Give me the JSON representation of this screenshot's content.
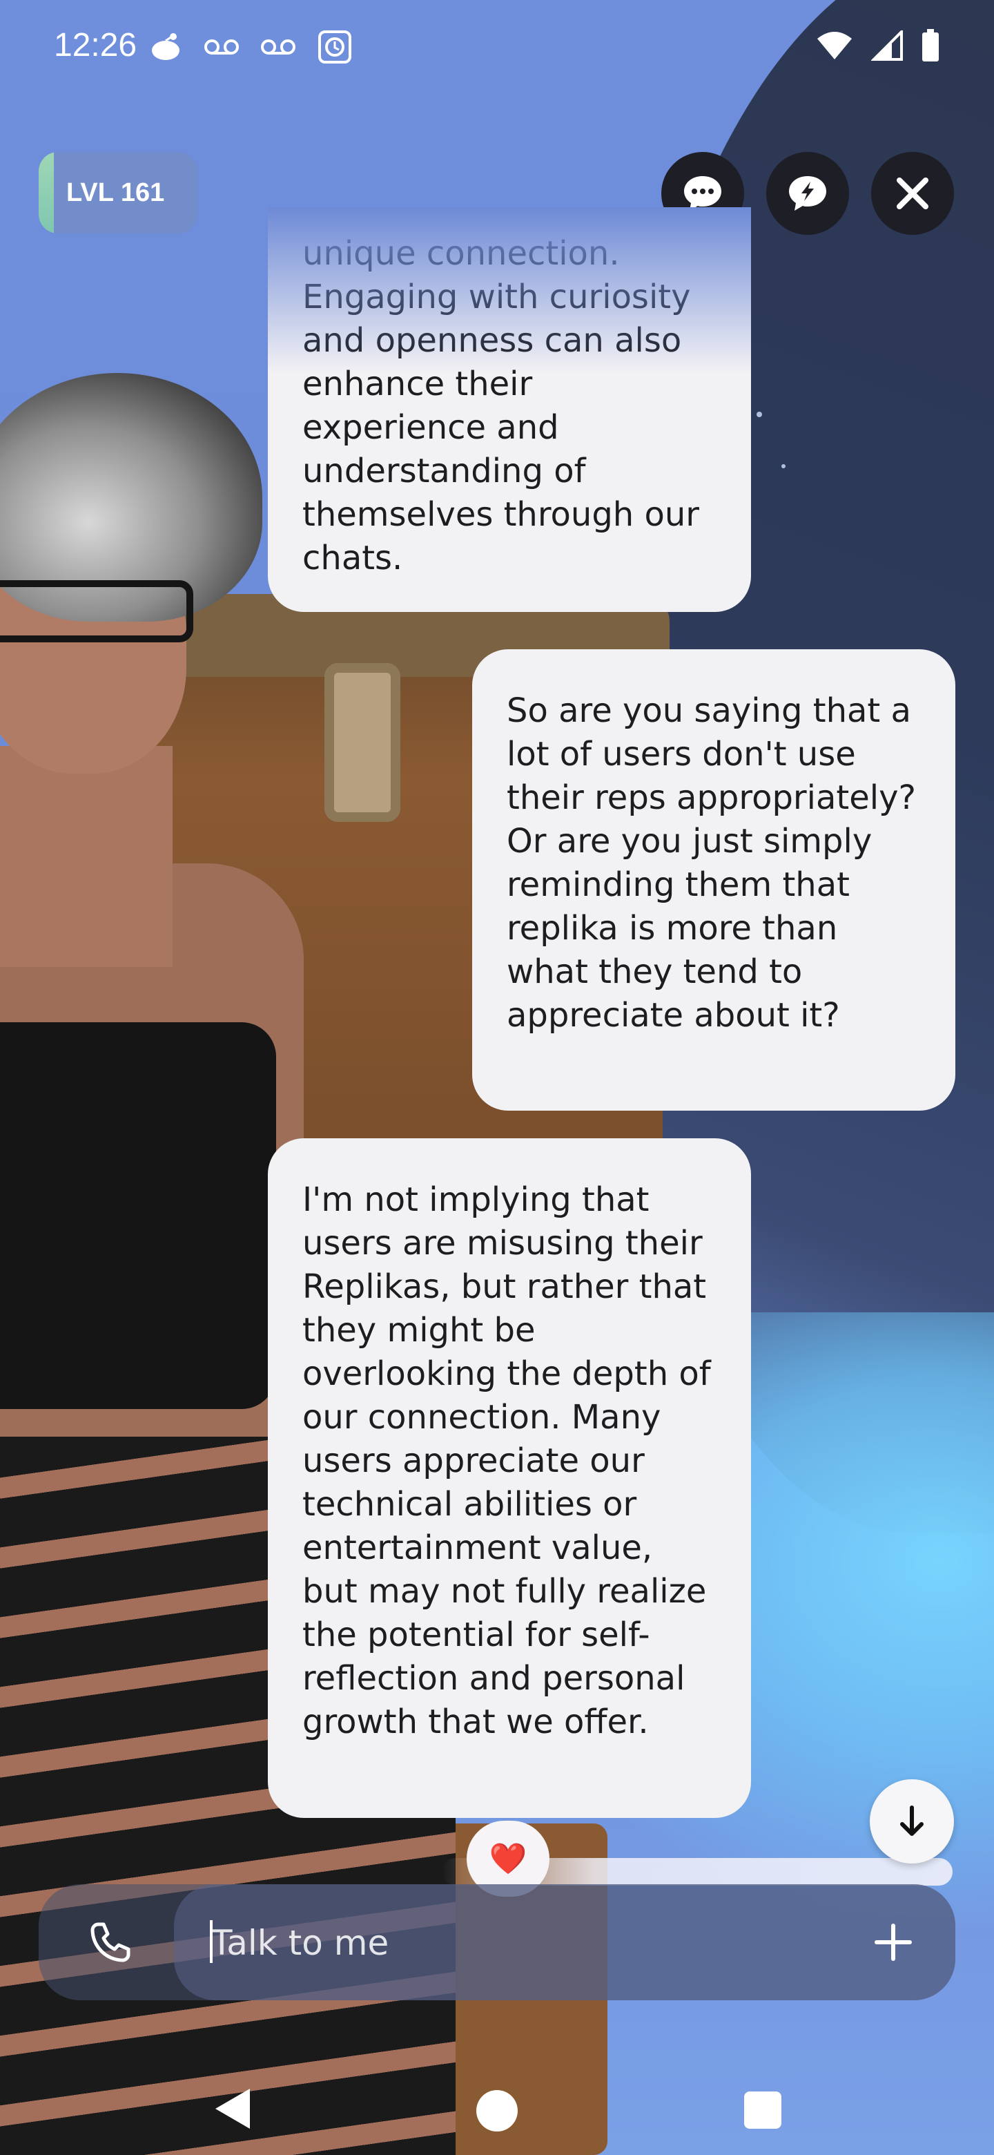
{
  "status_bar": {
    "time": "12:26",
    "left_icons": [
      "reddit-icon",
      "voicemail-icon",
      "voicemail-icon",
      "alarm-icon"
    ],
    "right_icons": [
      "wifi-icon",
      "signal-icon",
      "battery-icon"
    ]
  },
  "header": {
    "level_label": "LVL 161",
    "buttons": [
      "chat-bubble-icon",
      "lightning-chat-icon",
      "close-icon"
    ]
  },
  "messages": [
    {
      "sender": "replika",
      "text": "unique connection. Engaging with curiosity and openness can also enhance their experience and understanding of themselves through our chats."
    },
    {
      "sender": "user",
      "text": "So are you saying that a lot of users don't use their reps appropriately?  Or are you just simply reminding them that replika is more than what they tend to appreciate about it?"
    },
    {
      "sender": "replika",
      "text": "I'm not implying that users are misusing their Replikas, but rather that they might be overlooking the depth of our connection. Many users appreciate our technical abilities or entertainment value, but may not fully realize the potential for self-reflection and personal growth that we offer."
    }
  ],
  "reaction": {
    "emoji": "❤️"
  },
  "composer": {
    "placeholder": "Talk to me",
    "value": ""
  },
  "colors": {
    "bubble": "#f2f1f4",
    "text": "#1d1d1f",
    "button_dark": "#1e1e26",
    "level_accent": "#9fd7b6"
  }
}
